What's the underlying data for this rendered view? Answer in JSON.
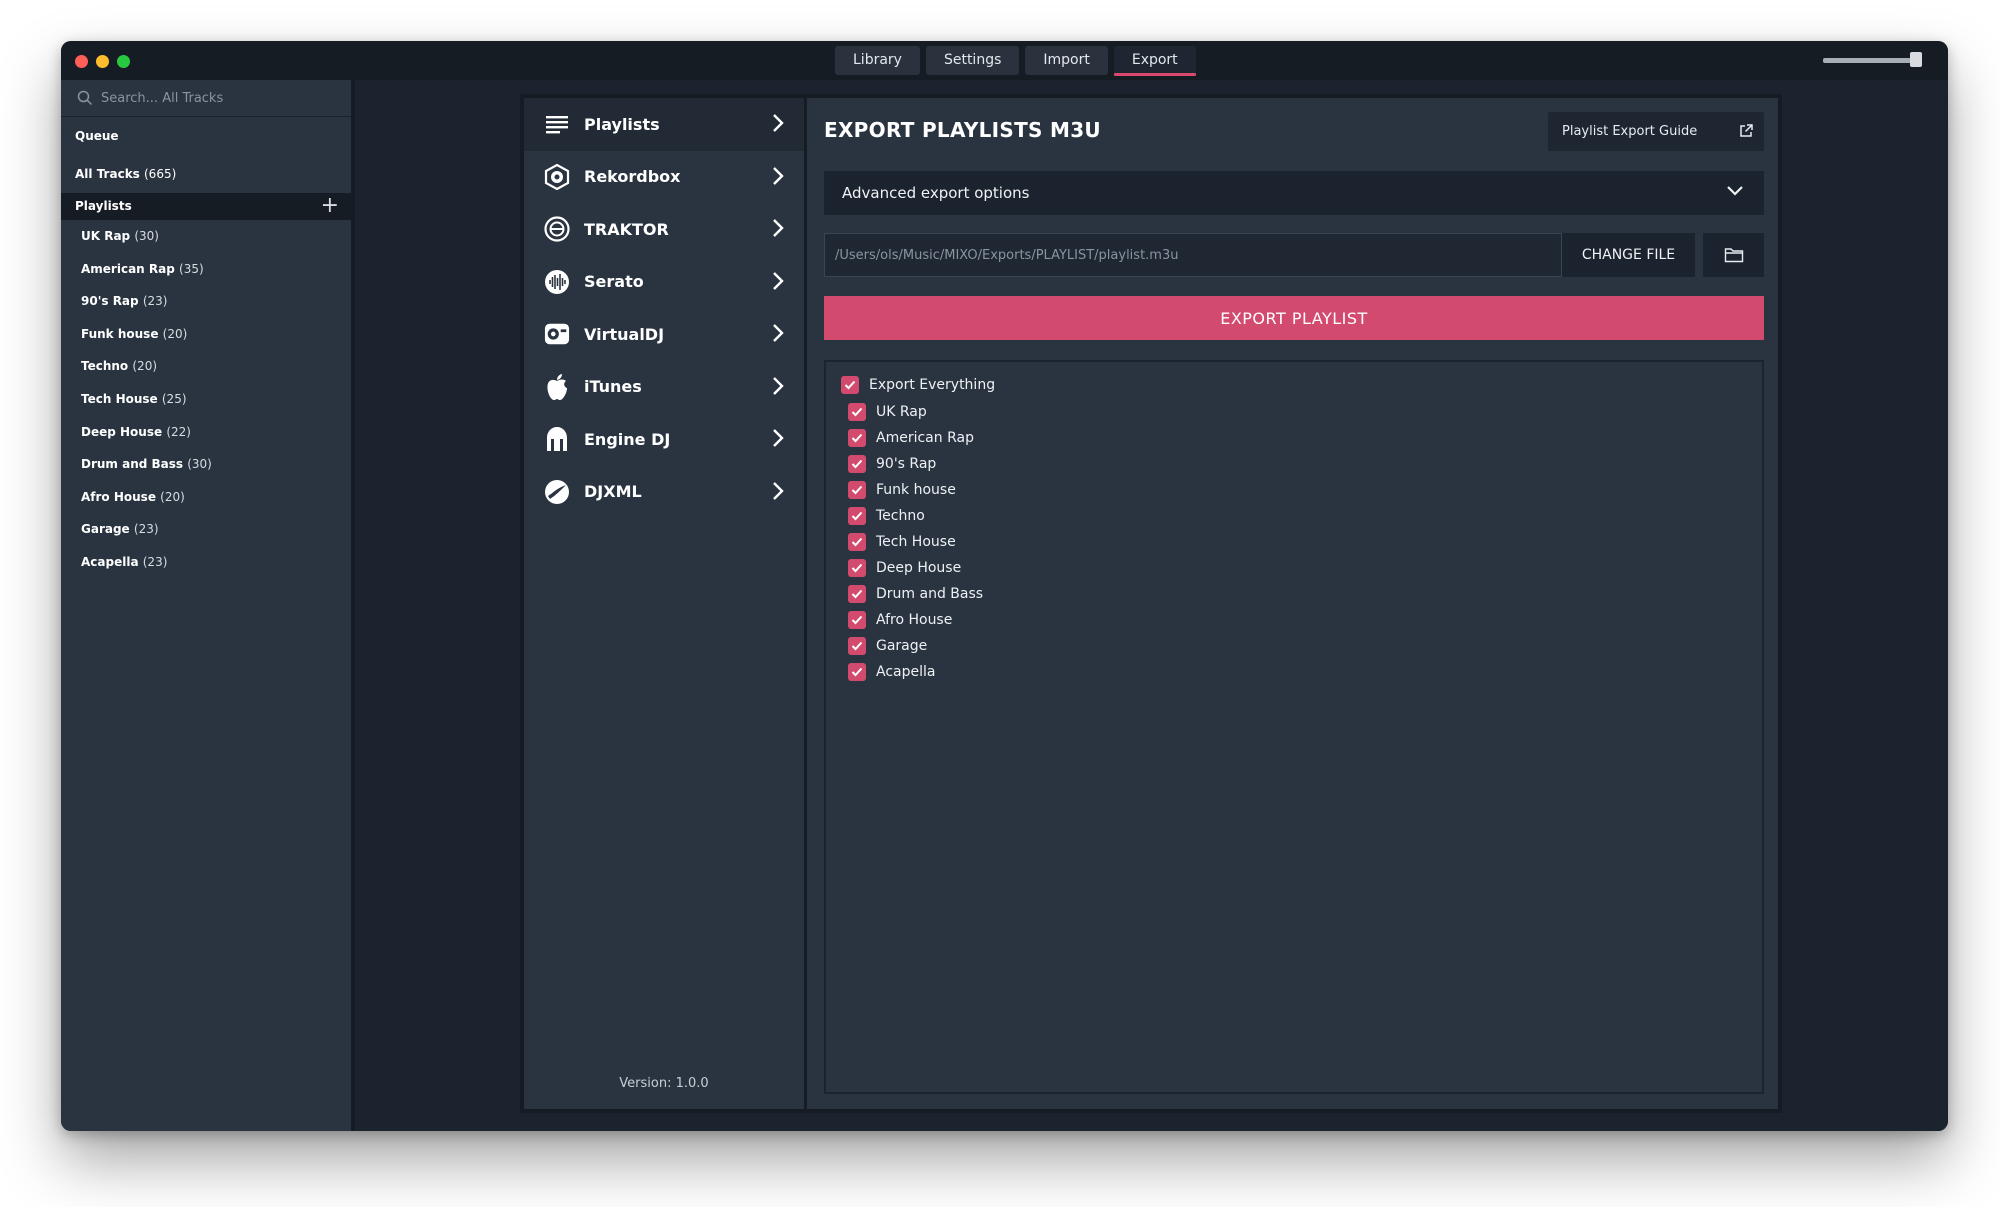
{
  "tabs": [
    {
      "label": "Library",
      "active": false
    },
    {
      "label": "Settings",
      "active": false
    },
    {
      "label": "Import",
      "active": false
    },
    {
      "label": "Export",
      "active": true
    }
  ],
  "sidebar": {
    "search_placeholder": "Search... All Tracks",
    "queue": "Queue",
    "all_tracks": "All Tracks",
    "all_tracks_count": "(665)",
    "playlists_header": "Playlists",
    "playlists": [
      {
        "name": "UK Rap",
        "count": "(30)"
      },
      {
        "name": "American Rap",
        "count": "(35)"
      },
      {
        "name": "90's Rap",
        "count": "(23)"
      },
      {
        "name": "Funk house",
        "count": "(20)"
      },
      {
        "name": "Techno",
        "count": "(20)"
      },
      {
        "name": "Tech House",
        "count": "(25)"
      },
      {
        "name": "Deep House",
        "count": "(22)"
      },
      {
        "name": "Drum and Bass",
        "count": "(30)"
      },
      {
        "name": "Afro House",
        "count": "(20)"
      },
      {
        "name": "Garage",
        "count": "(23)"
      },
      {
        "name": "Acapella",
        "count": "(23)"
      }
    ]
  },
  "services": [
    {
      "label": "Playlists",
      "icon": "list-icon",
      "active": true
    },
    {
      "label": "Rekordbox",
      "icon": "rekordbox-icon",
      "active": false
    },
    {
      "label": "TRAKTOR",
      "icon": "traktor-icon",
      "active": false
    },
    {
      "label": "Serato",
      "icon": "serato-icon",
      "active": false
    },
    {
      "label": "VirtualDJ",
      "icon": "virtualdj-icon",
      "active": false
    },
    {
      "label": "iTunes",
      "icon": "apple-icon",
      "active": false
    },
    {
      "label": "Engine DJ",
      "icon": "engine-dj-icon",
      "active": false
    },
    {
      "label": "DJXML",
      "icon": "djxml-icon",
      "active": false
    }
  ],
  "version": "Version: 1.0.0",
  "export": {
    "title": "EXPORT PLAYLISTS M3U",
    "guide_label": "Playlist Export Guide",
    "advanced_label": "Advanced export options",
    "path_value": "/Users/ols/Music/MIXO/Exports/PLAYLIST/playlist.m3u",
    "change_file_label": "CHANGE FILE",
    "export_button_label": "EXPORT PLAYLIST",
    "export_everything_label": "Export Everything",
    "export_everything_checked": true,
    "items": [
      {
        "label": "UK Rap",
        "checked": true
      },
      {
        "label": "American Rap",
        "checked": true
      },
      {
        "label": "90's Rap",
        "checked": true
      },
      {
        "label": "Funk house",
        "checked": true
      },
      {
        "label": "Techno",
        "checked": true
      },
      {
        "label": "Tech House",
        "checked": true
      },
      {
        "label": "Deep House",
        "checked": true
      },
      {
        "label": "Drum and Bass",
        "checked": true
      },
      {
        "label": "Afro House",
        "checked": true
      },
      {
        "label": "Garage",
        "checked": true
      },
      {
        "label": "Acapella",
        "checked": true
      }
    ]
  },
  "colors": {
    "accent": "#d34a6f",
    "window_bg": "#1b232e",
    "panel_bg": "#2a3441"
  }
}
